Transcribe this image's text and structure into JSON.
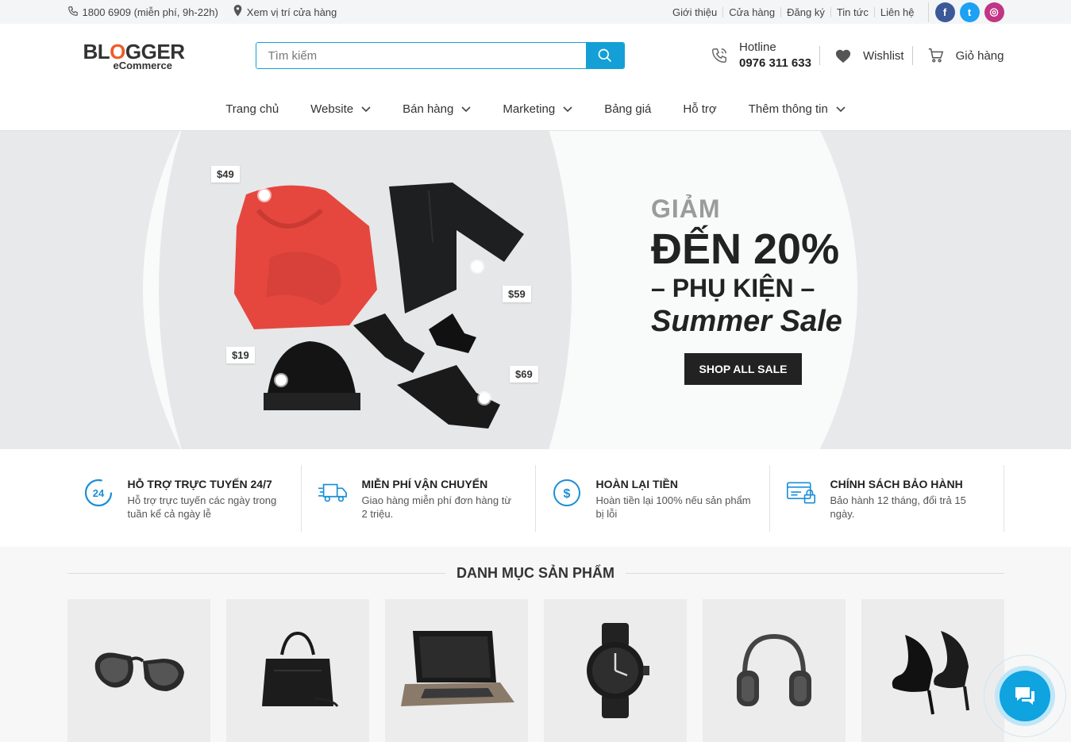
{
  "topbar": {
    "phone": "1800 6909 (miễn phí, 9h-22h)",
    "store_locator": "Xem vị trí cửa hàng",
    "links": [
      "Giới thiệu",
      "Cửa hàng",
      "Đăng ký",
      "Tin tức",
      "Liên hệ"
    ],
    "social": [
      {
        "icon": "facebook-icon",
        "glyph": "f",
        "color": "#3b5998"
      },
      {
        "icon": "twitter-icon",
        "glyph": "t",
        "color": "#1da1f2"
      },
      {
        "icon": "instagram-icon",
        "glyph": "◎",
        "color": "#c13584"
      }
    ]
  },
  "header": {
    "logo_main_pre": "BL",
    "logo_main_o": "O",
    "logo_main_post": "GGER",
    "logo_sub": "eCommerce",
    "search_placeholder": "Tìm kiếm",
    "hotline_label": "Hotline",
    "hotline_number": "0976 311 633",
    "wishlist": "Wishlist",
    "cart": "Giỏ hàng"
  },
  "nav": {
    "items": [
      {
        "label": "Trang chủ",
        "dropdown": false
      },
      {
        "label": "Website",
        "dropdown": true
      },
      {
        "label": "Bán hàng",
        "dropdown": true
      },
      {
        "label": "Marketing",
        "dropdown": true
      },
      {
        "label": "Bảng giá",
        "dropdown": false
      },
      {
        "label": "Hỗ trợ",
        "dropdown": false
      },
      {
        "label": "Thêm thông tin",
        "dropdown": true
      }
    ]
  },
  "hero": {
    "line1": "GIẢM",
    "line2": "ĐẾN 20%",
    "line3": "–  PHỤ KIỆN –",
    "line4": "Summer Sale",
    "button": "SHOP ALL SALE",
    "prices": [
      "$49",
      "$59",
      "$19",
      "$69"
    ]
  },
  "features": [
    {
      "icon": "support-24-icon",
      "title": "HỖ TRỢ TRỰC TUYẾN 24/7",
      "desc": "Hỗ trợ trực tuyến các ngày trong tuần kể cả ngày lễ",
      "badge": "24"
    },
    {
      "icon": "truck-icon",
      "title": "MIỄN PHÍ VẬN CHUYỂN",
      "desc": "Giao hàng miễn phí đơn hàng từ 2 triệu."
    },
    {
      "icon": "money-back-icon",
      "title": "HOÀN LẠI TIỀN",
      "desc": "Hoàn tiền lại 100% nếu sản phẩm bị lỗi"
    },
    {
      "icon": "warranty-card-icon",
      "title": "CHÍNH SÁCH BẢO HÀNH",
      "desc": "Bảo hành 12 tháng, đổi trả 15 ngày."
    }
  ],
  "categories": {
    "title": "DANH MỤC SẢN PHẨM",
    "items": [
      "sunglasses-image",
      "handbag-image",
      "laptop-image",
      "watch-image",
      "headphones-image",
      "high-heels-image"
    ]
  },
  "colors": {
    "accent": "#14a0d6",
    "dark": "#222222",
    "logo_o": "#f05a28"
  }
}
